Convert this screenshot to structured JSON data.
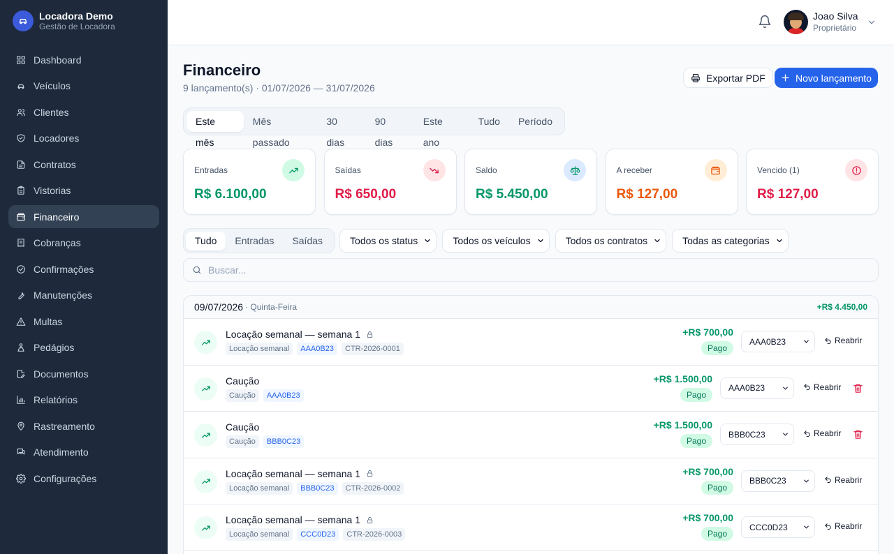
{
  "brand": {
    "name": "Locadora Demo",
    "subtitle": "Gestão de Locadora"
  },
  "sidebar": {
    "items": [
      {
        "label": "Dashboard",
        "icon": "grid-icon"
      },
      {
        "label": "Veículos",
        "icon": "car-icon"
      },
      {
        "label": "Clientes",
        "icon": "users-icon"
      },
      {
        "label": "Locadores",
        "icon": "shield-icon"
      },
      {
        "label": "Contratos",
        "icon": "file-icon"
      },
      {
        "label": "Vistorias",
        "icon": "clipboard-icon"
      },
      {
        "label": "Financeiro",
        "icon": "wallet-icon",
        "active": true
      },
      {
        "label": "Cobranças",
        "icon": "receipt-icon"
      },
      {
        "label": "Confirmações",
        "icon": "check-circle-icon"
      },
      {
        "label": "Manutenções",
        "icon": "wrench-icon"
      },
      {
        "label": "Multas",
        "icon": "alert-triangle-icon"
      },
      {
        "label": "Pedágios",
        "icon": "toll-icon"
      },
      {
        "label": "Documentos",
        "icon": "file-edit-icon"
      },
      {
        "label": "Relatórios",
        "icon": "bar-chart-icon"
      },
      {
        "label": "Rastreamento",
        "icon": "map-pin-icon"
      },
      {
        "label": "Atendimento",
        "icon": "messages-icon"
      },
      {
        "label": "Configurações",
        "icon": "gear-icon"
      }
    ]
  },
  "user": {
    "name": "Joao Silva",
    "role": "Proprietário"
  },
  "page": {
    "title": "Financeiro",
    "subtitle": "9 lançamento(s) · 01/07/2026 — 31/07/2026",
    "export_label": "Exportar PDF",
    "new_label": "Novo lançamento"
  },
  "period_tabs": [
    "Este mês",
    "Mês passado",
    "30 dias",
    "90 dias",
    "Este ano",
    "Tudo",
    "Período"
  ],
  "period_active": "Este mês",
  "summary": [
    {
      "label": "Entradas",
      "value": "R$ 6.100,00",
      "color": "#059669",
      "icon": "trending-up-icon",
      "icon_bg": "#d1fae5"
    },
    {
      "label": "Saídas",
      "value": "R$ 650,00",
      "color": "#e11d48",
      "icon": "trending-down-icon",
      "icon_bg": "#ffe4e6"
    },
    {
      "label": "Saldo",
      "value": "R$ 5.450,00",
      "color": "#059669",
      "icon": "scale-icon",
      "icon_bg": "#dbeafe"
    },
    {
      "label": "A receber",
      "value": "R$ 127,00",
      "color": "#ea580c",
      "icon": "wallet-icon",
      "icon_bg": "#ffedd5"
    },
    {
      "label": "Vencido (1)",
      "value": "R$ 127,00",
      "color": "#e11d48",
      "icon": "alert-circle-icon",
      "icon_bg": "#ffe4e6"
    }
  ],
  "type_tabs": [
    "Tudo",
    "Entradas",
    "Saídas"
  ],
  "type_active": "Tudo",
  "filters": [
    "Todos os status",
    "Todos os veículos",
    "Todos os contratos",
    "Todas as categorias"
  ],
  "search": {
    "placeholder": "Buscar..."
  },
  "groups": [
    {
      "date": "09/07/2026",
      "weekday": "· Quinta-Feira",
      "total": "+R$ 4.450,00",
      "entries": [
        {
          "title": "Locação semanal — semana 1",
          "locked": true,
          "category": "Locação semanal",
          "plate": "AAA0B23",
          "contract": "CTR-2026-0001",
          "amount": "+R$ 700,00",
          "status": "Pago",
          "vehicle": "AAA0B23",
          "reopen": "Reabrir",
          "deletable": false
        },
        {
          "title": "Caução",
          "locked": false,
          "category": "Caução",
          "plate": "AAA0B23",
          "contract": "",
          "amount": "+R$ 1.500,00",
          "status": "Pago",
          "vehicle": "AAA0B23",
          "reopen": "Reabrir",
          "deletable": true
        },
        {
          "title": "Caução",
          "locked": false,
          "category": "Caução",
          "plate": "BBB0C23",
          "contract": "",
          "amount": "+R$ 1.500,00",
          "status": "Pago",
          "vehicle": "BBB0C23",
          "reopen": "Reabrir",
          "deletable": true
        },
        {
          "title": "Locação semanal — semana 1",
          "locked": true,
          "category": "Locação semanal",
          "plate": "BBB0C23",
          "contract": "CTR-2026-0002",
          "amount": "+R$ 700,00",
          "status": "Pago",
          "vehicle": "BBB0C23",
          "reopen": "Reabrir",
          "deletable": false
        },
        {
          "title": "Locação semanal — semana 1",
          "locked": true,
          "category": "Locação semanal",
          "plate": "CCC0D23",
          "contract": "CTR-2026-0003",
          "amount": "+R$ 700,00",
          "status": "Pago",
          "vehicle": "CCC0D23",
          "reopen": "Reabrir",
          "deletable": false
        }
      ]
    }
  ]
}
